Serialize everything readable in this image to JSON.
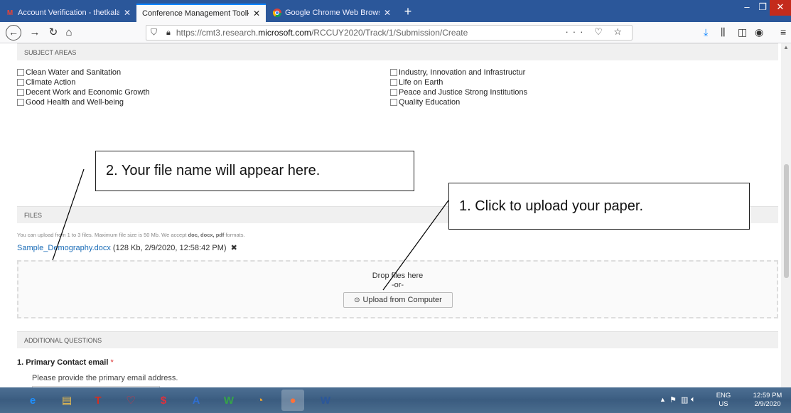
{
  "tabs": [
    {
      "title": "Account Verification - thetkala",
      "icon": "gmail-icon",
      "close": "✕"
    },
    {
      "title": "Conference Management Toolkit -",
      "icon": "",
      "close": "✕"
    },
    {
      "title": "Google Chrome Web Browser",
      "icon": "chrome-icon",
      "close": "✕"
    }
  ],
  "browser": {
    "new_tab": "+",
    "url_prefix": "https://cmt3.research.",
    "url_host": "microsoft.com",
    "url_path": "/RCCUY2020/Track/1/Submission/Create",
    "page_actions": "··· ♡ ☆"
  },
  "subjects": {
    "header": "SUBJECT AREAS",
    "left": [
      "Clean Water and Sanitation",
      "Climate Action",
      "Decent Work and Economic Growth",
      "Good Health and Well-being"
    ],
    "right": [
      "Industry, Innovation and Infrastructur",
      "Life on Earth",
      "Peace and Justice Strong Institutions",
      "Quality Education"
    ]
  },
  "files": {
    "header": "FILES",
    "help_prefix": "You can upload from 1 to 3 files. Maximum file size is 50 Mb. We accept ",
    "help_formats": "doc, docx, pdf",
    "help_suffix": " formats.",
    "file_name": "Sample_Demography.docx",
    "file_meta": " (128 Kb, 2/9/2020, 12:58:42 PM)",
    "delete_glyph": "✖",
    "drop_text": "Drop files here",
    "or_text": "-or-",
    "upload_icon": "⊙",
    "upload_label": "Upload from Computer"
  },
  "additional": {
    "header": "ADDITIONAL QUESTIONS",
    "q1_title": "1. Primary Contact email",
    "q1_required": " *",
    "q1_desc": "Please provide the primary email address."
  },
  "callouts": {
    "one": "1. Click to upload your paper.",
    "two": "2. Your file name will appear here."
  },
  "taskbar": {
    "apps": [
      {
        "icon": "internet-explorer-icon",
        "glyph": "e",
        "color": "#1e90ff"
      },
      {
        "icon": "file-explorer-icon",
        "glyph": "▤",
        "color": "#f3c14b"
      },
      {
        "icon": "t-app-icon",
        "glyph": "T",
        "color": "#d62d20"
      },
      {
        "icon": "heart-app-icon",
        "glyph": "♡",
        "color": "#e0303c"
      },
      {
        "icon": "dollar-app-icon",
        "glyph": "$",
        "color": "#e0303c"
      },
      {
        "icon": "a-app-icon",
        "glyph": "A",
        "color": "#2f6fd1"
      },
      {
        "icon": "w-app-icon",
        "glyph": "W",
        "color": "#35a547"
      },
      {
        "icon": "gauge-app-icon",
        "glyph": "◔",
        "color": "#f2a52b"
      },
      {
        "icon": "firefox-icon",
        "glyph": "●",
        "color": "#ff7139"
      },
      {
        "icon": "word-icon",
        "glyph": "W",
        "color": "#2b579a"
      }
    ],
    "lang": "ENG",
    "region": "US",
    "time": "12:59 PM",
    "date": "2/9/2020"
  }
}
